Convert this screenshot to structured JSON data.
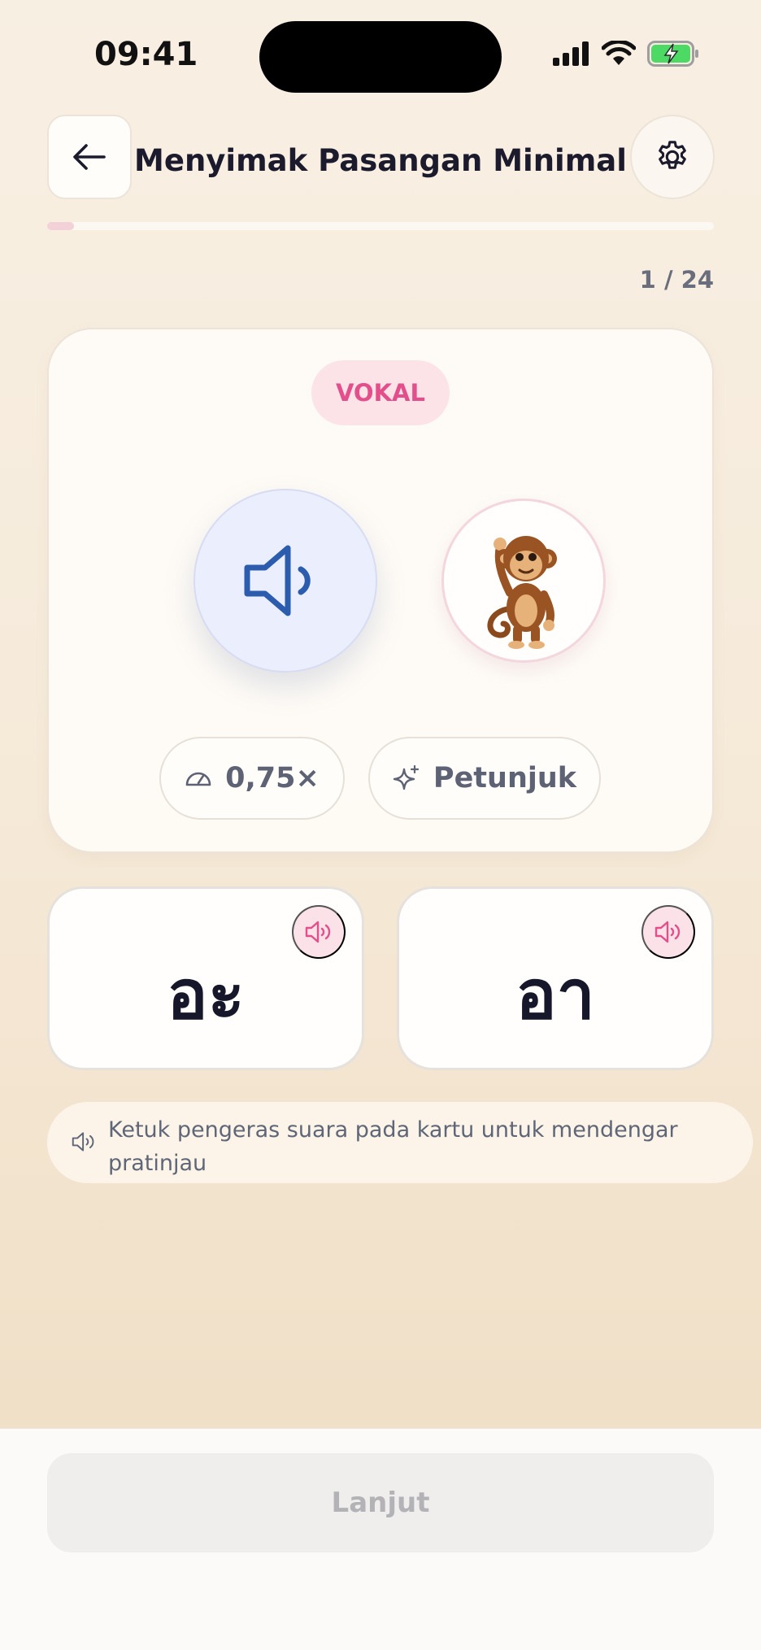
{
  "status_bar": {
    "time": "09:41"
  },
  "header": {
    "title": "Menyimak Pasangan Minimal"
  },
  "progress": {
    "current": 1,
    "total": 24,
    "label": "1 / 24",
    "fill_fraction": 0.04
  },
  "card": {
    "badge": "VOKAL",
    "speed_label": "0,75×",
    "hint_label": "Petunjuk"
  },
  "choices": [
    {
      "text": "อะ"
    },
    {
      "text": "อา"
    }
  ],
  "tip": {
    "text": "Ketuk pengeras suara pada kartu untuk mendengar pratinjau"
  },
  "footer": {
    "next_label": "Lanjut"
  },
  "colors": {
    "accent_pink": "#e24f8b",
    "speaker_blue": "#2b5cad",
    "title_dark": "#1c1b2e",
    "muted_text": "#5f6677"
  },
  "icons": {
    "back": "arrow-left-icon",
    "settings": "gear-icon",
    "play": "speaker-icon",
    "speed": "speedometer-icon",
    "hint": "sparkle-icon",
    "preview": "speaker-icon",
    "mascot": "monkey-mascot"
  }
}
